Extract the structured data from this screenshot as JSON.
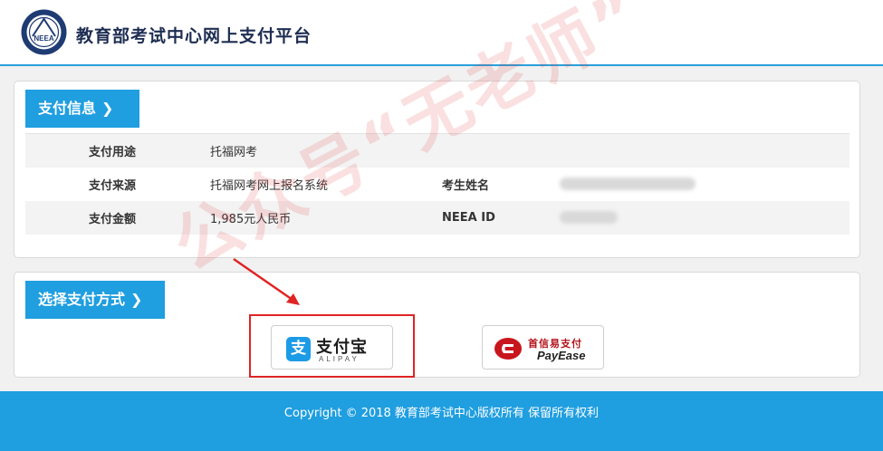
{
  "header": {
    "logo_text": "NEEA",
    "title": "教育部考试中心网上支付平台"
  },
  "payment_info": {
    "section_title": "支付信息",
    "rows": [
      {
        "label": "支付用途",
        "value": "托福网考"
      },
      {
        "label": "支付来源",
        "value": "托福网考网上报名系统",
        "label2": "考生姓名"
      },
      {
        "label": "支付金额",
        "value": "1,985元人民币",
        "label2": "NEEA ID"
      }
    ]
  },
  "payment_method": {
    "section_title": "选择支付方式",
    "alipay": {
      "icon_char": "支",
      "name_cn": "支付宝",
      "name_en": "ALIPAY"
    },
    "payease": {
      "name_cn": "首信易支付",
      "name_en": "PayEase"
    }
  },
  "watermark": "公众号“无老师”",
  "footer": {
    "copyright": "Copyright © 2018 教育部考试中心版权所有 保留所有权利"
  },
  "colors": {
    "accent": "#1f9ee0",
    "title": "#1e2d52",
    "highlight": "#e02424"
  }
}
